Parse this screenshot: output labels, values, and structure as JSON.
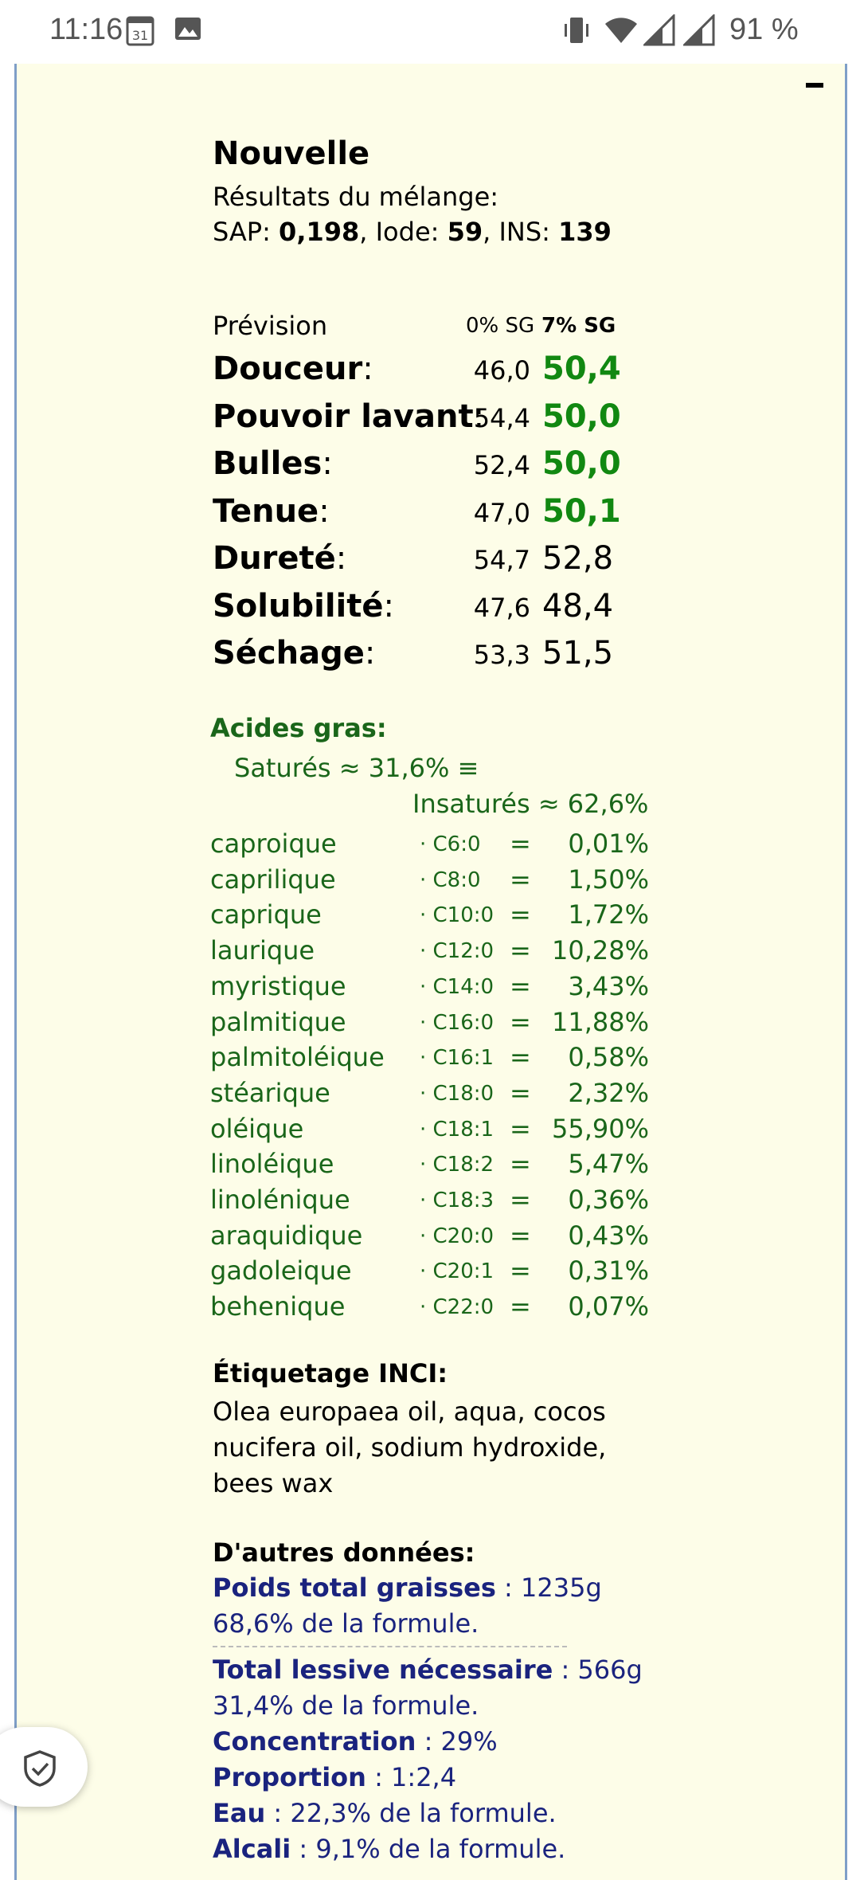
{
  "status_bar": {
    "time": "11:16",
    "calendar_day": "31",
    "battery": "91 %"
  },
  "recipe": {
    "name": "Nouvelle",
    "results_label": "Résultats du mélange:",
    "sap_label": "SAP:",
    "sap": "0,198",
    "iode_label": "Iode:",
    "iode": "59",
    "ins_label": "INS:",
    "ins": "139"
  },
  "forecast": {
    "label": "Prévision",
    "col_0": "0% SG",
    "col_7": "7% SG",
    "rows": [
      {
        "name": "Douceur",
        "v0": "46,0",
        "v7": "50,4",
        "highlight": true
      },
      {
        "name": "Pouvoir lavant",
        "v0": "54,4",
        "v7": "50,0",
        "highlight": true
      },
      {
        "name": "Bulles",
        "v0": "52,4",
        "v7": "50,0",
        "highlight": true
      },
      {
        "name": "Tenue",
        "v0": "47,0",
        "v7": "50,1",
        "highlight": true
      },
      {
        "name": "Dureté",
        "v0": "54,7",
        "v7": "52,8",
        "highlight": false
      },
      {
        "name": "Solubilité",
        "v0": "47,6",
        "v7": "48,4",
        "highlight": false
      },
      {
        "name": "Séchage",
        "v0": "53,3",
        "v7": "51,5",
        "highlight": false
      }
    ]
  },
  "fatty_acids": {
    "heading": "Acides gras:",
    "saturated": "Saturés ≈ 31,6% ≡",
    "unsaturated": "Insaturés ≈ 62,6%",
    "items": [
      {
        "name": "caproique",
        "code": "· C6:0",
        "pct": "0,01%"
      },
      {
        "name": "caprilique",
        "code": "· C8:0",
        "pct": "1,50%"
      },
      {
        "name": "caprique",
        "code": "· C10:0",
        "pct": "1,72%"
      },
      {
        "name": "laurique",
        "code": "· C12:0",
        "pct": "10,28%"
      },
      {
        "name": "myristique",
        "code": "· C14:0",
        "pct": "3,43%"
      },
      {
        "name": "palmitique",
        "code": "· C16:0",
        "pct": "11,88%"
      },
      {
        "name": "palmitoléique",
        "code": "· C16:1",
        "pct": "0,58%"
      },
      {
        "name": "stéarique",
        "code": "· C18:0",
        "pct": "2,32%"
      },
      {
        "name": "oléique",
        "code": "· C18:1",
        "pct": "55,90%"
      },
      {
        "name": "linoléique",
        "code": "· C18:2",
        "pct": "5,47%"
      },
      {
        "name": "linolénique",
        "code": "· C18:3",
        "pct": "0,36%"
      },
      {
        "name": "araquidique",
        "code": "· C20:0",
        "pct": "0,43%"
      },
      {
        "name": "gadoleique",
        "code": "· C20:1",
        "pct": "0,31%"
      },
      {
        "name": "behenique",
        "code": "· C22:0",
        "pct": "0,07%"
      }
    ]
  },
  "inci": {
    "heading": "Étiquetage INCI:",
    "text": "Olea europaea oil, aqua, cocos nucifera oil, sodium hydroxide, bees wax"
  },
  "other": {
    "heading": "D'autres données:",
    "fats_label": "Poids total graisses",
    "fats_value": " : 1235g",
    "fats_pct": "68,6% de la formule.",
    "lye_label": "Total lessive nécessaire",
    "lye_value": " : 566g",
    "lye_pct": "31,4% de la formule.",
    "conc_label": "Concentration",
    "conc_value": " : 29%",
    "prop_label": "Proportion",
    "prop_value": " : 1:2,4",
    "water_label": "Eau",
    "water_value": " : 22,3% de la formule.",
    "alkali_label": "Alcali",
    "alkali_value": " : 9,1% de la formule."
  }
}
